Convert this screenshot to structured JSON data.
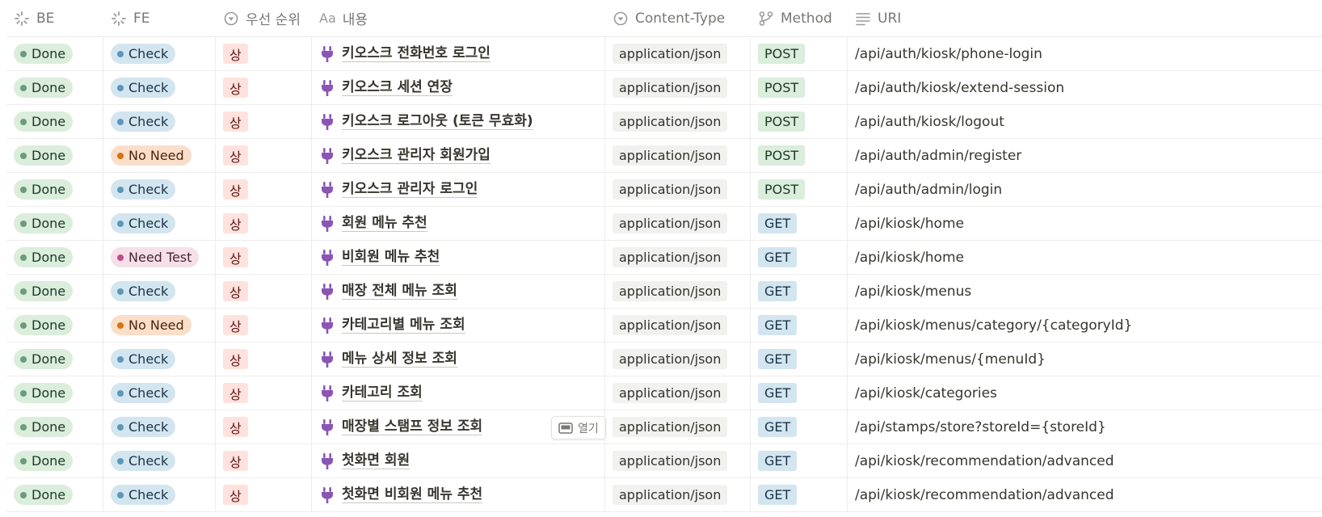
{
  "columns": {
    "be": "BE",
    "fe": "FE",
    "priority": "우선 순위",
    "content": "내용",
    "content_prefix": "Aa",
    "content_type": "Content-Type",
    "method": "Method",
    "uri": "URI"
  },
  "open_button_label": "열기",
  "colors": {
    "plug_icon": "#8a55b5",
    "done": "#dbeddb",
    "check": "#d3e5ef",
    "no_need": "#fadec9",
    "need_test": "#f5e0e9",
    "priority_tag": "#ffe2dd"
  },
  "rows": [
    {
      "be": "Done",
      "fe": "Check",
      "fe_style": "check",
      "priority": "상",
      "title": "키오스크 전화번호 로그인",
      "content_type": "application/json",
      "method": "POST",
      "uri": "/api/auth/kiosk/phone-login"
    },
    {
      "be": "Done",
      "fe": "Check",
      "fe_style": "check",
      "priority": "상",
      "title": "키오스크 세션 연장",
      "content_type": "application/json",
      "method": "POST",
      "uri": "/api/auth/kiosk/extend-session"
    },
    {
      "be": "Done",
      "fe": "Check",
      "fe_style": "check",
      "priority": "상",
      "title": "키오스크 로그아웃 (토큰 무효화)",
      "content_type": "application/json",
      "method": "POST",
      "uri": "/api/auth/kiosk/logout"
    },
    {
      "be": "Done",
      "fe": "No Need",
      "fe_style": "noneed",
      "priority": "상",
      "title": "키오스크 관리자 회원가입",
      "content_type": "application/json",
      "method": "POST",
      "uri": "/api/auth/admin/register"
    },
    {
      "be": "Done",
      "fe": "Check",
      "fe_style": "check",
      "priority": "상",
      "title": "키오스크 관리자 로그인",
      "content_type": "application/json",
      "method": "POST",
      "uri": "/api/auth/admin/login"
    },
    {
      "be": "Done",
      "fe": "Check",
      "fe_style": "check",
      "priority": "상",
      "title": "회원 메뉴 추천",
      "content_type": "application/json",
      "method": "GET",
      "uri": "/api/kiosk/home"
    },
    {
      "be": "Done",
      "fe": "Need Test",
      "fe_style": "needtest",
      "priority": "상",
      "title": "비회원 메뉴 추천",
      "content_type": "application/json",
      "method": "GET",
      "uri": "/api/kiosk/home"
    },
    {
      "be": "Done",
      "fe": "Check",
      "fe_style": "check",
      "priority": "상",
      "title": "매장 전체 메뉴 조회",
      "content_type": "application/json",
      "method": "GET",
      "uri": "/api/kiosk/menus"
    },
    {
      "be": "Done",
      "fe": "No Need",
      "fe_style": "noneed",
      "priority": "상",
      "title": "카테고리별 메뉴 조회",
      "content_type": "application/json",
      "method": "GET",
      "uri": "/api/kiosk/menus/category/{categoryId}"
    },
    {
      "be": "Done",
      "fe": "Check",
      "fe_style": "check",
      "priority": "상",
      "title": "메뉴 상세 정보 조회",
      "content_type": "application/json",
      "method": "GET",
      "uri": "/api/kiosk/menus/{menuId}"
    },
    {
      "be": "Done",
      "fe": "Check",
      "fe_style": "check",
      "priority": "상",
      "title": "카테고리 조회",
      "content_type": "application/json",
      "method": "GET",
      "uri": "/api/kiosk/categories"
    },
    {
      "be": "Done",
      "fe": "Check",
      "fe_style": "check",
      "priority": "상",
      "title": "매장별 스탬프 정보 조회",
      "content_type": "application/json",
      "method": "GET",
      "uri": "/api/stamps/store?storeId={storeId}",
      "show_open": true
    },
    {
      "be": "Done",
      "fe": "Check",
      "fe_style": "check",
      "priority": "상",
      "title": "첫화면 회원",
      "content_type": "application/json",
      "method": "GET",
      "uri": "/api/kiosk/recommendation/advanced"
    },
    {
      "be": "Done",
      "fe": "Check",
      "fe_style": "check",
      "priority": "상",
      "title": "첫화면 비회원 메뉴 추천",
      "content_type": "application/json",
      "method": "GET",
      "uri": "/api/kiosk/recommendation/advanced"
    }
  ]
}
